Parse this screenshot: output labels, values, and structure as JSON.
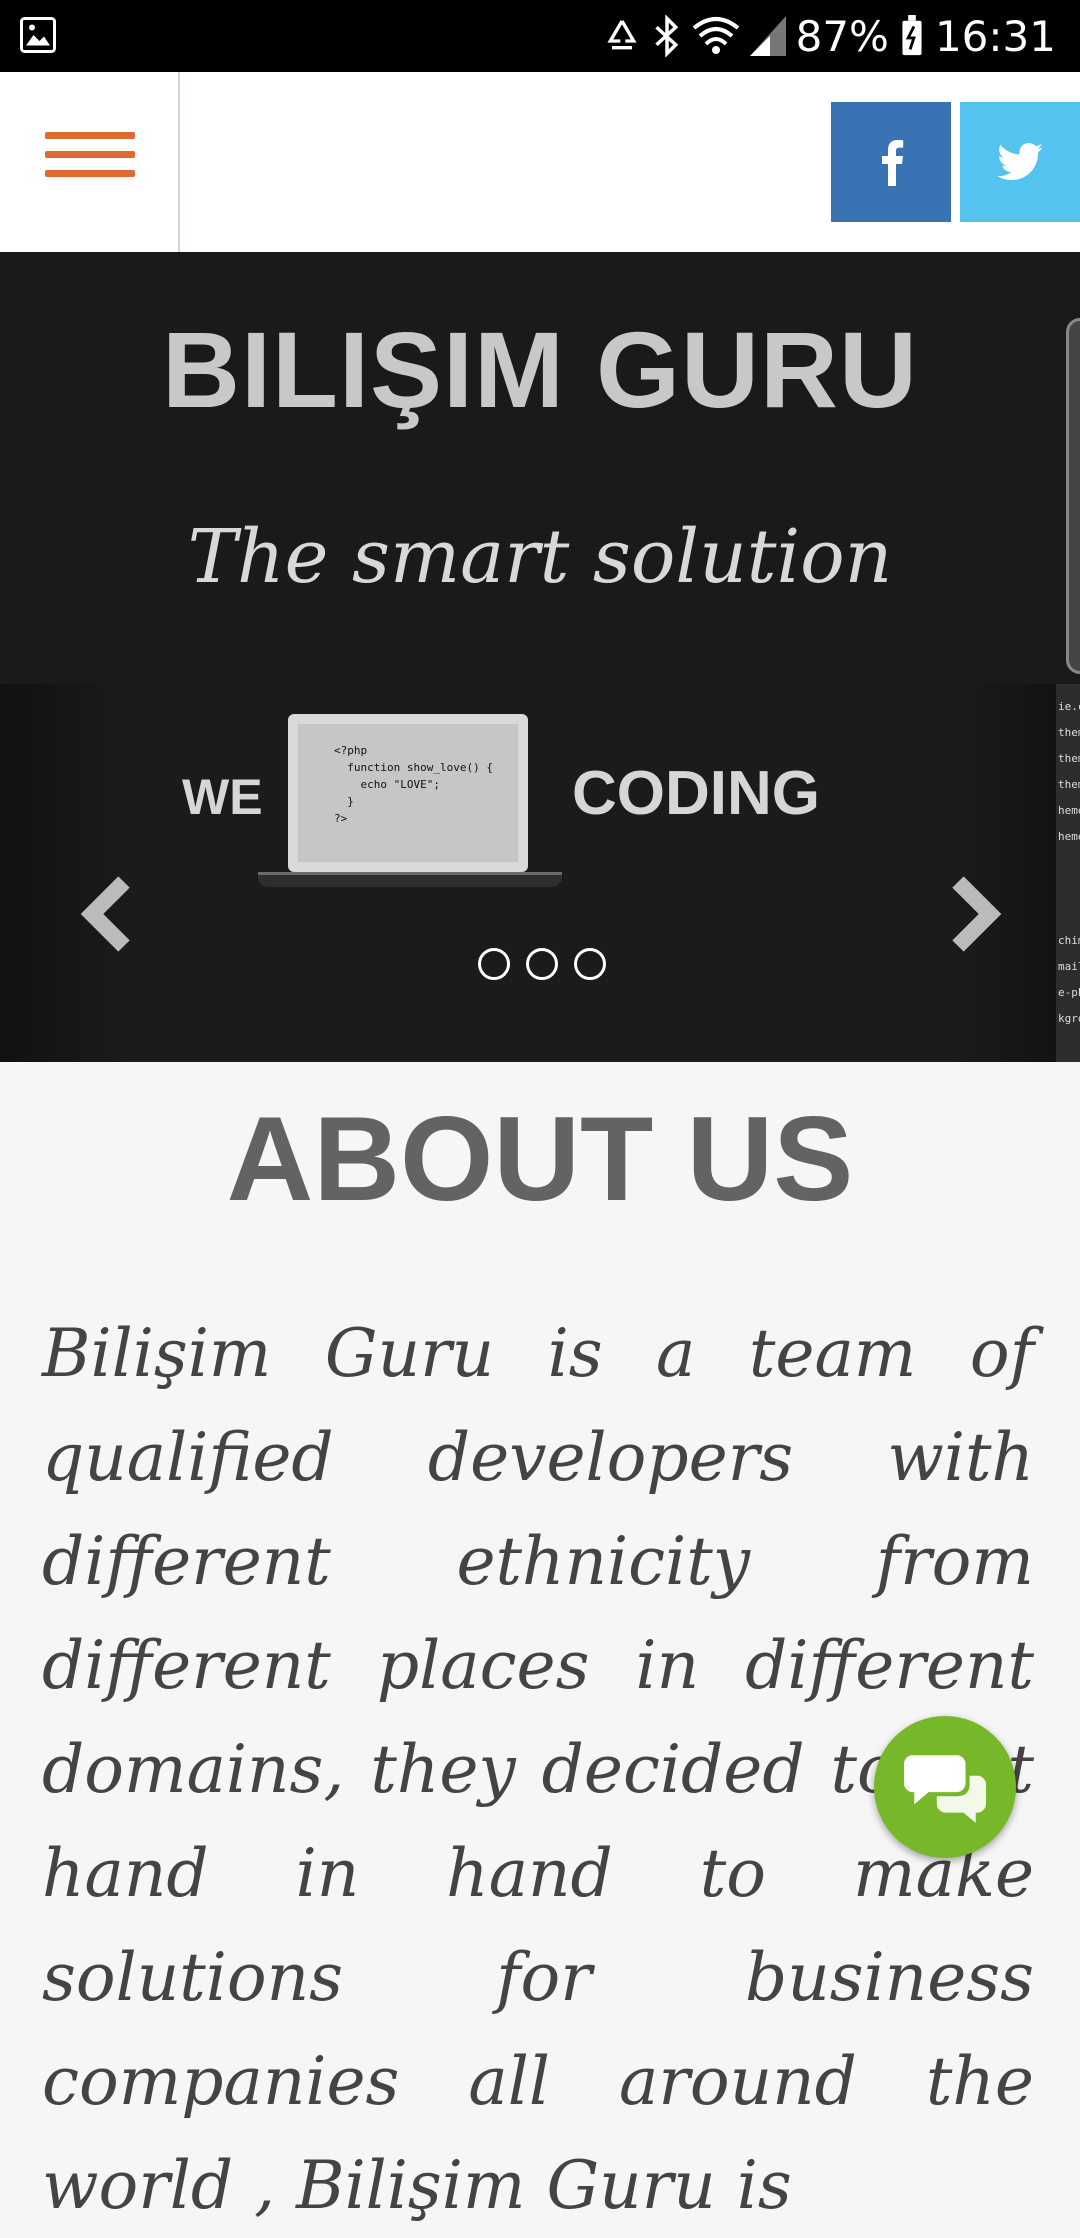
{
  "status_bar": {
    "battery": "87%",
    "time": "16:31",
    "icons": [
      "gallery-icon",
      "recycle-icon",
      "bluetooth-icon",
      "wifi-icon",
      "signal-icon",
      "battery-icon"
    ]
  },
  "header": {
    "menu_icon": "hamburger-icon",
    "social": [
      {
        "name": "facebook",
        "label": "f",
        "color": "#3a73b4"
      },
      {
        "name": "twitter",
        "label": "twitter",
        "color": "#55c3f0"
      }
    ]
  },
  "hero": {
    "title": "BILIŞIM GURU",
    "tagline": "The smart solution"
  },
  "slider": {
    "word_left": "WE",
    "word_right": "CODING",
    "code": "<?php\n  function show_love() {\n    echo \"LOVE\";\n  }\n?>",
    "dots_count": 3,
    "side_code": "ie.cs\nthem\nthem\nthem\nheme-\nheme-\n\n\n\nchimp\nmailer\ne-php\nkgrou\n\ns"
  },
  "about": {
    "heading": "ABOUT US",
    "text": "Bilişim Guru is a team of qualified developers with different ethnicity from different places in different domains, they decided to put hand in hand to make solutions for business companies all around the world , Bilişim Guru is"
  },
  "colors": {
    "accent": "#e06a2f",
    "chat": "#77b82a"
  }
}
